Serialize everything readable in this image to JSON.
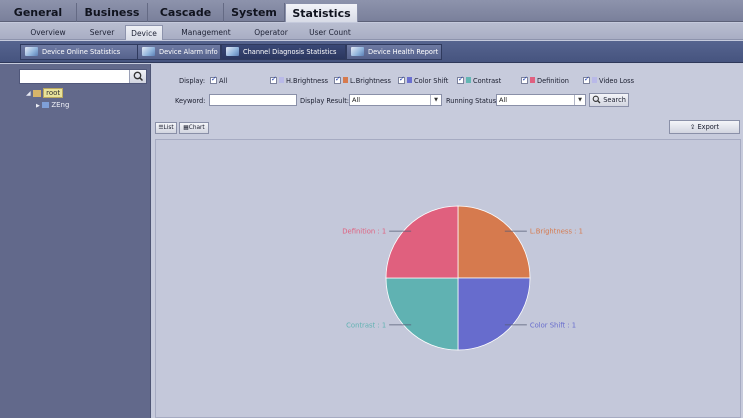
{
  "top_tabs": [
    "General",
    "Business",
    "Cascade",
    "System",
    "Statistics"
  ],
  "top_tab_active": "Statistics",
  "sub_tabs": [
    "Overview",
    "Server",
    "Device",
    "Management",
    "Operator",
    "User Count"
  ],
  "sub_tab_active": "Device",
  "toolbar": {
    "buttons": [
      "Device Online Statistics",
      "Device Alarm Info",
      "Channel Diagnosis Statistics",
      "Device Health Report"
    ],
    "active": "Channel Diagnosis Statistics"
  },
  "tree": {
    "search_placeholder": "",
    "root_label": "root",
    "child_label": "ZEng"
  },
  "filters": {
    "display_label": "Display:",
    "options": [
      {
        "label": "All",
        "checked": true,
        "color": ""
      },
      {
        "label": "H.Brightness",
        "checked": true,
        "color": "#b9b9e8"
      },
      {
        "label": "L.Brightness",
        "checked": true,
        "color": "#d67a4e"
      },
      {
        "label": "Color Shift",
        "checked": true,
        "color": "#6a6fd0"
      },
      {
        "label": "Contrast",
        "checked": true,
        "color": "#63b6b3"
      },
      {
        "label": "Definition",
        "checked": true,
        "color": "#e06080"
      },
      {
        "label": "Video Loss",
        "checked": true,
        "color": "#b9b9e8"
      }
    ],
    "keyword_label": "Keyword:",
    "keyword_value": "",
    "display_result_label": "Display Result:",
    "display_result_value": "All",
    "running_status_label": "Running Status:",
    "running_status_value": "All",
    "search_button": "Search"
  },
  "view_buttons": {
    "list": "List",
    "chart": "Chart"
  },
  "export_button": "Export",
  "chart_data": {
    "type": "pie",
    "slices": [
      {
        "label": "L.Brightness",
        "value": 1,
        "color": "#d67a4e",
        "text": "L.Brightness : 1"
      },
      {
        "label": "Color Shift",
        "value": 1,
        "color": "#676ccd",
        "text": "Color Shift : 1"
      },
      {
        "label": "Contrast",
        "value": 1,
        "color": "#60b2b2",
        "text": "Contrast : 1"
      },
      {
        "label": "Definition",
        "value": 1,
        "color": "#e0607e",
        "text": "Definition : 1"
      }
    ]
  }
}
